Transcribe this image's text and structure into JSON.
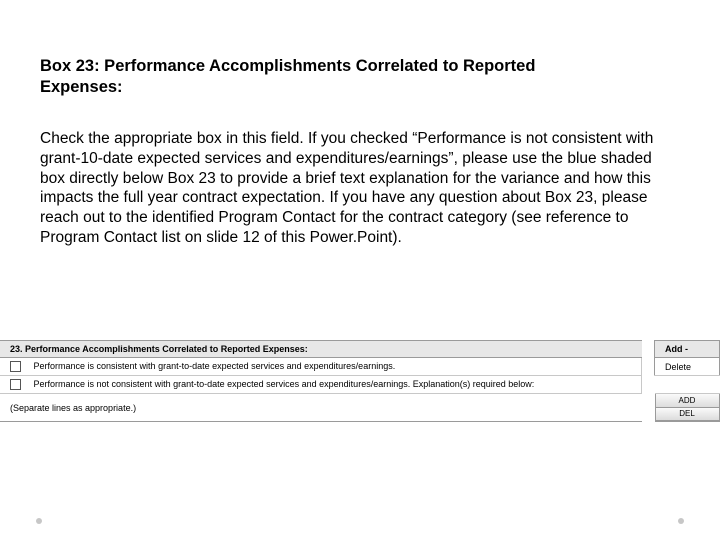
{
  "heading": "Box 23:  Performance Accomplishments Correlated to Reported Expenses:",
  "body": "Check the appropriate box in this field.  If you checked “Performance is not consistent with grant-10-date expected services and expenditures/earnings”, please use the blue shaded box directly below Box 23 to provide a brief text explanation for the variance and how this impacts the full year contract expectation.  If you have any question about Box 23, please reach out to the identified Program Contact for the contract category (see reference to Program Contact list on slide 12 of this Power.Point).",
  "form": {
    "header": "23. Performance Accomplishments Correlated to Reported Expenses:",
    "side_header_top": "Add -",
    "side_header_bottom": "Delete",
    "option1": "Performance is consistent with grant-to-date expected services and expenditures/earnings.",
    "option2": "Performance is not consistent with grant-to-date expected services and expenditures/earnings. Explanation(s) required below:",
    "separate": "(Separate lines as appropriate.)",
    "btn_add": "ADD",
    "btn_del": "DEL"
  }
}
